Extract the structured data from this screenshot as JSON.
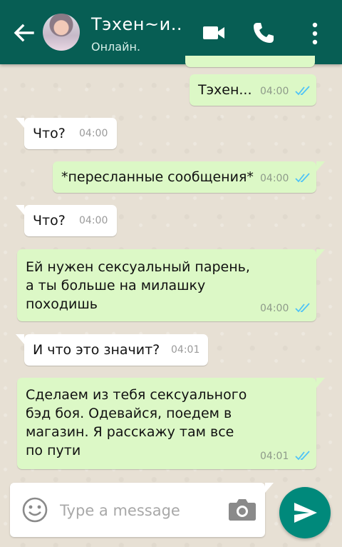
{
  "header": {
    "contact_name": "Тэхен~и..",
    "status": "Онлайн."
  },
  "messages": [
    {
      "direction": "out",
      "text": "Тэхен...",
      "time": "04:00",
      "read": true
    },
    {
      "direction": "in",
      "text": "Что?",
      "time": "04:00"
    },
    {
      "direction": "out",
      "text": "*пересланные сообщения*",
      "time": "04:00",
      "read": true
    },
    {
      "direction": "in",
      "text": "Что?",
      "time": "04:00"
    },
    {
      "direction": "out",
      "text": "Ей нужен сексуальный парень,\nа ты больше на милашку\nпоходишь",
      "time": "04:00",
      "read": true
    },
    {
      "direction": "in",
      "text": "И что это значит?",
      "time": "04:01"
    },
    {
      "direction": "out",
      "text": "Сделаем из тебя сексуального\nбэд боя. Одевайся, поедем в\nмагазин. Я расскажу там все\nпо пути",
      "time": "04:01",
      "read": true
    }
  ],
  "composer": {
    "placeholder": "Type a message"
  },
  "colors": {
    "header": "#075e54",
    "outgoing_bubble": "#dcf8c6",
    "incoming_bubble": "#ffffff",
    "read_ticks": "#4fc3f7",
    "send_button": "#00897b"
  }
}
